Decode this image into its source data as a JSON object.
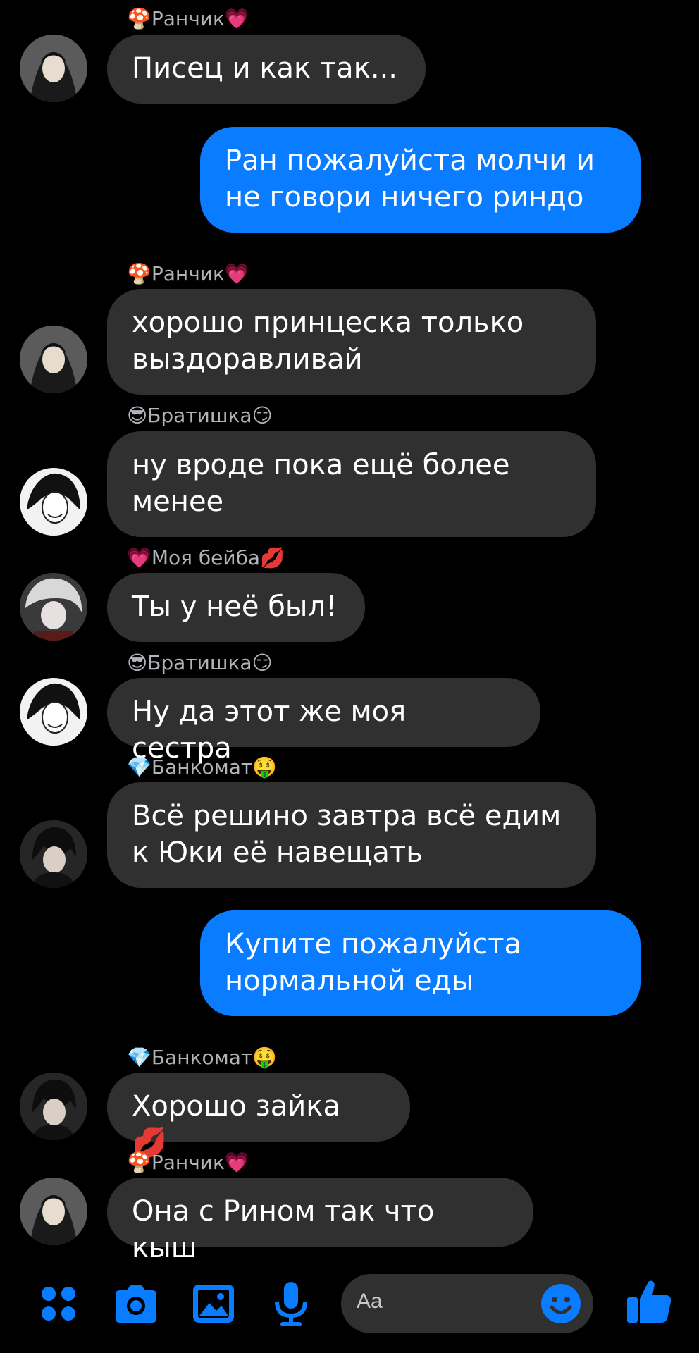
{
  "accent_color": "#0a7cff",
  "bubble_color": "#303030",
  "messages": [
    {
      "sender": "🍄Ранчик💗",
      "text": "Писец и как так..."
    },
    {
      "text": "Ран пожалуйста молчи и\nне говори ничего риндо"
    },
    {
      "sender": "🍄Ранчик💗",
      "text": "хорошо принцеска только\nвыздоравливай"
    },
    {
      "sender": "😎Братишка😏",
      "text": "ну вроде пока ещё более\nменее"
    },
    {
      "sender": "💗Моя бейба💋",
      "text": "Ты у неё был!"
    },
    {
      "sender": "😎Братишка😏",
      "text": "Ну да этот же моя сестра"
    },
    {
      "sender": "💎Банкомат🤑",
      "text": "Всё решино завтра всё едим\nк Юки её навещать"
    },
    {
      "text": "Купите пожалуйста\nнормальной еды"
    },
    {
      "sender": "💎Банкомат🤑",
      "text": "Хорошо зайка 💋"
    },
    {
      "sender": "🍄Ранчик💗",
      "text": "Она с Рином так что кыш"
    }
  ],
  "composer": {
    "placeholder": "Aa",
    "icons": [
      "menu-dots-icon",
      "camera-icon",
      "gallery-icon",
      "microphone-icon",
      "emoji-icon",
      "thumbs-up-icon"
    ]
  }
}
